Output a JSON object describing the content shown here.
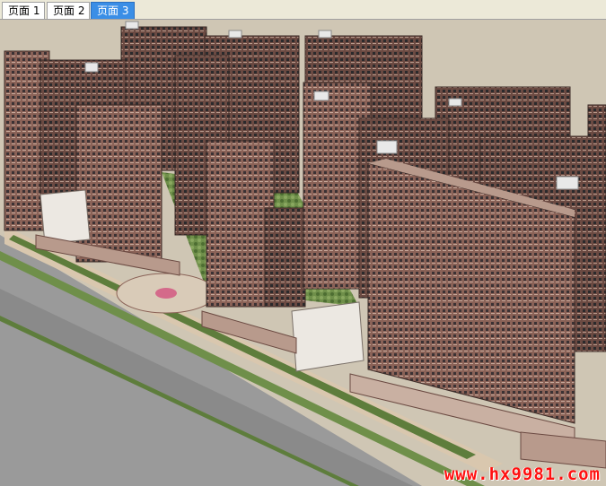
{
  "tabs": [
    {
      "label": "页面 1",
      "active": false
    },
    {
      "label": "页面 2",
      "active": false
    },
    {
      "label": "页面 3",
      "active": true
    }
  ],
  "scene": {
    "description_free": true,
    "colors": {
      "background": "#cfc6b4",
      "road": "#8a8a8a",
      "greenery": "#6f8f4a",
      "facade": "#6b4a42",
      "facade_light": "#a98a80",
      "podium": "#e9e4dc",
      "active_tab": "#3a8ee6"
    }
  },
  "watermark": {
    "text": "www.hx9981.com",
    "color": "#ff1010"
  }
}
